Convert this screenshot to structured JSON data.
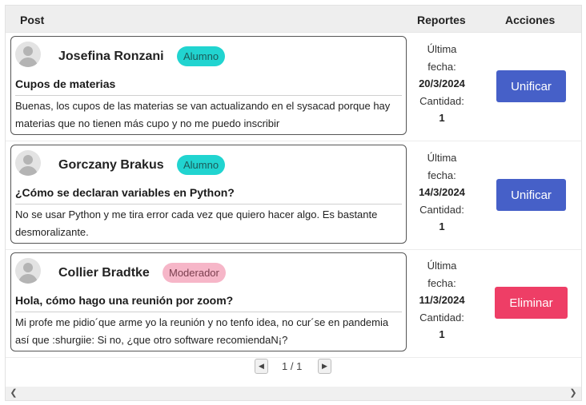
{
  "table": {
    "headers": {
      "post": "Post",
      "reportes": "Reportes",
      "acciones": "Acciones"
    }
  },
  "reports_labels": {
    "ultima": "Última",
    "fecha": "fecha:",
    "cantidad": "Cantidad:"
  },
  "rows": [
    {
      "author": "Josefina Ronzani",
      "role": "Alumno",
      "title": "Cupos de materias",
      "content": "Buenas, los cupos de las materias se van actualizando en el sysacad porque hay materias que no tienen más cupo y no me puedo inscribir",
      "date": "20/3/2024",
      "count": "1",
      "action": "Unificar"
    },
    {
      "author": "Gorczany Brakus",
      "role": "Alumno",
      "title": "¿Cómo se declaran variables en Python?",
      "content": "No se usar Python y me tira error cada vez que quiero hacer algo. Es bastante desmoralizante.",
      "date": "14/3/2024",
      "count": "1",
      "action": "Unificar"
    },
    {
      "author": "Collier Bradtke",
      "role": "Moderador",
      "title": "Hola, cómo hago una reunión por zoom?",
      "content": "Mi profe me pidio´que arme yo la reunión y no tenfo idea, no cur´se en pandemia así que :shurgiie: Si no, ¿que otro software recomiendaN¡?",
      "date": "11/3/2024",
      "count": "1",
      "action": "Eliminar"
    }
  ],
  "pagination": {
    "text": "1 / 1"
  },
  "colors": {
    "alumno_badge": "#21d4d0",
    "moderador_badge": "#f6b6c8",
    "unificar_button": "#4660c8",
    "eliminar_button": "#ee3e66"
  },
  "icons": {
    "avatar": "user-avatar-icon",
    "prev": "chevron-left-icon",
    "next": "chevron-right-icon"
  }
}
